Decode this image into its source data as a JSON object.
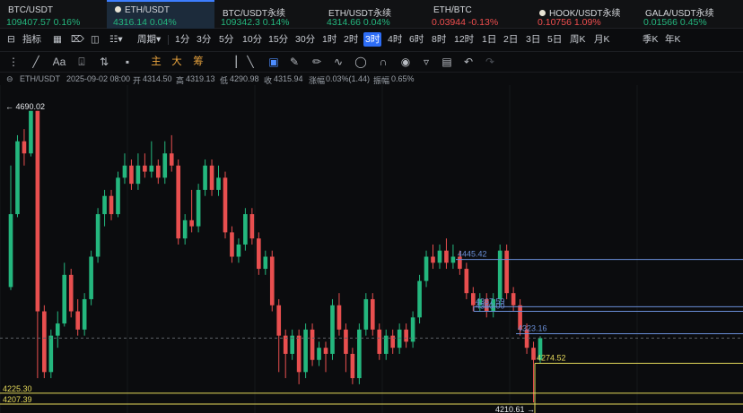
{
  "tickers": [
    {
      "name": "BTC/USDT",
      "price": "109407.57",
      "change": "0.16%",
      "dir": "up",
      "active": false,
      "dot": false
    },
    {
      "name": "ETH/USDT",
      "price": "4316.14",
      "change": "0.04%",
      "dir": "up",
      "active": true,
      "dot": true
    },
    {
      "name": "BTC/USDT永续",
      "price": "109342.3",
      "change": "0.14%",
      "dir": "up",
      "active": false,
      "dot": false
    },
    {
      "name": "ETH/USDT永续",
      "price": "4314.66",
      "change": "0.04%",
      "dir": "up",
      "active": false,
      "dot": false
    },
    {
      "name": "ETH/BTC",
      "price": "0.03944",
      "change": "-0.13%",
      "dir": "dn",
      "active": false,
      "dot": false
    },
    {
      "name": "HOOK/USDT永续",
      "price": "0.10756",
      "change": "1.09%",
      "dir": "dn",
      "active": false,
      "dot": true
    },
    {
      "name": "GALA/USDT永续",
      "price": "0.01566",
      "change": "0.45%",
      "dir": "up",
      "active": false,
      "dot": false
    }
  ],
  "timeframe": {
    "indicator_label": "指标",
    "period_label": "周期",
    "intervals": [
      "1分",
      "3分",
      "5分",
      "10分",
      "15分",
      "30分",
      "1时",
      "2时",
      "3时",
      "4时",
      "6时",
      "8时",
      "12时",
      "1日",
      "2日",
      "3日",
      "5日",
      "周K",
      "月K",
      "季K",
      "年K"
    ],
    "active_interval": "3时"
  },
  "draw_tools": {
    "labels": [
      "主",
      "大",
      "筹"
    ]
  },
  "info": {
    "symbol": "ETH/USDT",
    "datetime": "2025-09-02 08:00",
    "open_label": "开",
    "open": "4314.50",
    "high_label": "高",
    "high": "4319.13",
    "low_label": "低",
    "low": "4290.98",
    "close_label": "收",
    "close": "4315.94",
    "chg_label": "涨幅",
    "chg": "0.03%(1.44)",
    "amp_label": "振幅",
    "amp": "0.65%"
  },
  "chart_data": {
    "type": "candlestick",
    "symbol": "ETH/USDT",
    "interval": "3时",
    "ylim": [
      4200,
      4700
    ],
    "candles": [
      [
        4400,
        4520,
        4395,
        4600
      ],
      [
        4520,
        4640,
        4515,
        4650
      ],
      [
        4640,
        4620,
        4600,
        4660
      ],
      [
        4620,
        4690,
        4615,
        4690
      ],
      [
        4690,
        4360,
        4250,
        4690
      ],
      [
        4360,
        4260,
        4250,
        4370
      ],
      [
        4260,
        4320,
        4250,
        4330
      ],
      [
        4320,
        4340,
        4300,
        4360
      ],
      [
        4340,
        4420,
        4335,
        4440
      ],
      [
        4420,
        4360,
        4350,
        4430
      ],
      [
        4360,
        4330,
        4320,
        4380
      ],
      [
        4330,
        4380,
        4320,
        4390
      ],
      [
        4380,
        4450,
        4370,
        4460
      ],
      [
        4450,
        4520,
        4440,
        4530
      ],
      [
        4520,
        4550,
        4500,
        4560
      ],
      [
        4550,
        4520,
        4510,
        4560
      ],
      [
        4520,
        4580,
        4515,
        4590
      ],
      [
        4580,
        4600,
        4570,
        4620
      ],
      [
        4600,
        4570,
        4560,
        4610
      ],
      [
        4570,
        4600,
        4560,
        4620
      ],
      [
        4600,
        4590,
        4580,
        4620
      ],
      [
        4590,
        4600,
        4580,
        4640
      ],
      [
        4600,
        4580,
        4570,
        4610
      ],
      [
        4580,
        4620,
        4570,
        4640
      ],
      [
        4620,
        4600,
        4590,
        4650
      ],
      [
        4600,
        4480,
        4470,
        4610
      ],
      [
        4480,
        4510,
        4470,
        4520
      ],
      [
        4510,
        4500,
        4490,
        4560
      ],
      [
        4500,
        4560,
        4490,
        4570
      ],
      [
        4560,
        4600,
        4550,
        4610
      ],
      [
        4600,
        4560,
        4550,
        4610
      ],
      [
        4560,
        4580,
        4550,
        4600
      ],
      [
        4580,
        4490,
        4480,
        4590
      ],
      [
        4490,
        4450,
        4440,
        4500
      ],
      [
        4450,
        4470,
        4440,
        4480
      ],
      [
        4470,
        4520,
        4460,
        4530
      ],
      [
        4520,
        4480,
        4470,
        4530
      ],
      [
        4480,
        4430,
        4420,
        4490
      ],
      [
        4430,
        4450,
        4420,
        4460
      ],
      [
        4450,
        4370,
        4360,
        4460
      ],
      [
        4370,
        4320,
        4260,
        4380
      ],
      [
        4320,
        4290,
        4250,
        4330
      ],
      [
        4290,
        4320,
        4280,
        4330
      ],
      [
        4320,
        4260,
        4240,
        4330
      ],
      [
        4260,
        4330,
        4250,
        4340
      ],
      [
        4330,
        4280,
        4270,
        4340
      ],
      [
        4280,
        4300,
        4270,
        4310
      ],
      [
        4300,
        4290,
        4260,
        4310
      ],
      [
        4290,
        4370,
        4280,
        4380
      ],
      [
        4370,
        4330,
        4320,
        4390
      ],
      [
        4330,
        4290,
        4260,
        4340
      ],
      [
        4290,
        4250,
        4240,
        4300
      ],
      [
        4250,
        4330,
        4240,
        4340
      ],
      [
        4330,
        4380,
        4320,
        4390
      ],
      [
        4380,
        4330,
        4320,
        4390
      ],
      [
        4330,
        4290,
        4280,
        4340
      ],
      [
        4290,
        4320,
        4280,
        4330
      ],
      [
        4320,
        4300,
        4290,
        4330
      ],
      [
        4300,
        4330,
        4290,
        4340
      ],
      [
        4330,
        4310,
        4300,
        4340
      ],
      [
        4310,
        4350,
        4300,
        4360
      ],
      [
        4350,
        4410,
        4340,
        4420
      ],
      [
        4410,
        4450,
        4400,
        4460
      ],
      [
        4450,
        4440,
        4430,
        4470
      ],
      [
        4440,
        4460,
        4430,
        4470
      ],
      [
        4460,
        4440,
        4430,
        4480
      ],
      [
        4440,
        4450,
        4430,
        4470
      ],
      [
        4450,
        4430,
        4420,
        4460
      ],
      [
        4430,
        4390,
        4380,
        4440
      ],
      [
        4390,
        4370,
        4360,
        4400
      ],
      [
        4370,
        4380,
        4360,
        4390
      ],
      [
        4380,
        4360,
        4350,
        4390
      ],
      [
        4360,
        4380,
        4350,
        4390
      ],
      [
        4380,
        4460,
        4370,
        4470
      ],
      [
        4460,
        4390,
        4380,
        4470
      ],
      [
        4390,
        4370,
        4360,
        4400
      ],
      [
        4370,
        4330,
        4320,
        4380
      ],
      [
        4330,
        4300,
        4290,
        4340
      ],
      [
        4300,
        4280,
        4210,
        4310
      ],
      [
        4280,
        4316,
        4274,
        4319
      ]
    ],
    "price_lines": [
      {
        "value": 4445.42,
        "label": "4445.42",
        "color": "#6a8fd8"
      },
      {
        "value": 4367.59,
        "label": "4367.59",
        "color": "#6a8fd8"
      },
      {
        "value": 4360.0,
        "label": "4360.00",
        "color": "#6a8fd8"
      },
      {
        "value": 4323.16,
        "label": "4323.16",
        "color": "#6a8fd8"
      },
      {
        "value": 4274.52,
        "label": "4274.52",
        "color": "#e4d85a"
      },
      {
        "value": 4225.3,
        "label": "4225.30",
        "color": "#e4d85a"
      },
      {
        "value": 4207.39,
        "label": "4207.39",
        "color": "#e4d85a"
      }
    ],
    "high_marker": {
      "value": 4690.02,
      "label": "4690.02"
    },
    "low_marker": {
      "value": 4210.61,
      "label": "4210.61"
    },
    "current_price": 4315.94,
    "up_color": "#24b77e",
    "down_color": "#e84f4f"
  }
}
